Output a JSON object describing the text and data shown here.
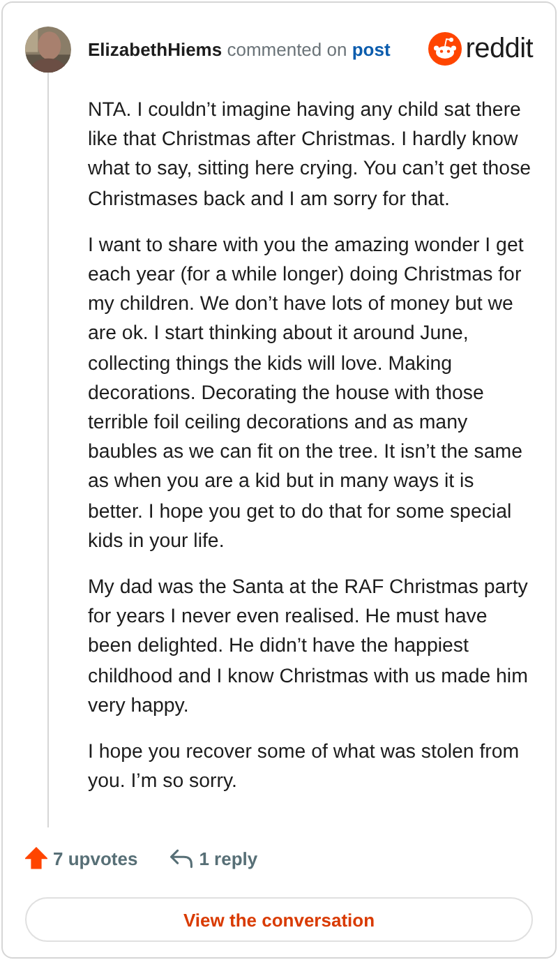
{
  "comment": {
    "author": "ElizabethHiems",
    "action": "commented on",
    "link": "post",
    "brand": "reddit",
    "paragraphs": [
      "NTA. I couldn’t imagine having any child sat there like that Christmas after Christmas. I hardly know what to say, sitting here crying. You can’t get those Christmases back and I am sorry for that.",
      "I want to share with you the amazing wonder I get each year (for a while longer) doing Christmas for my children. We don’t have lots of money but we are ok. I start thinking about it around June, collecting things the kids will love. Making decorations. Decorating the house with those terrible foil ceiling decorations and as many baubles as we can fit on the tree. It isn’t the same as when you are a kid but in many ways it is better. I hope you get to do that for some special kids in your life.",
      "My dad was the Santa at the RAF Christmas party for years I never even realised. He must have been delighted. He didn’t have the happiest childhood and I know Christmas with us made him very happy.",
      "I hope you recover some of what was stolen from you. I’m so sorry."
    ],
    "upvotes": "7 upvotes",
    "upvoted": true,
    "replies": "1 reply"
  },
  "button": "View the conversation"
}
